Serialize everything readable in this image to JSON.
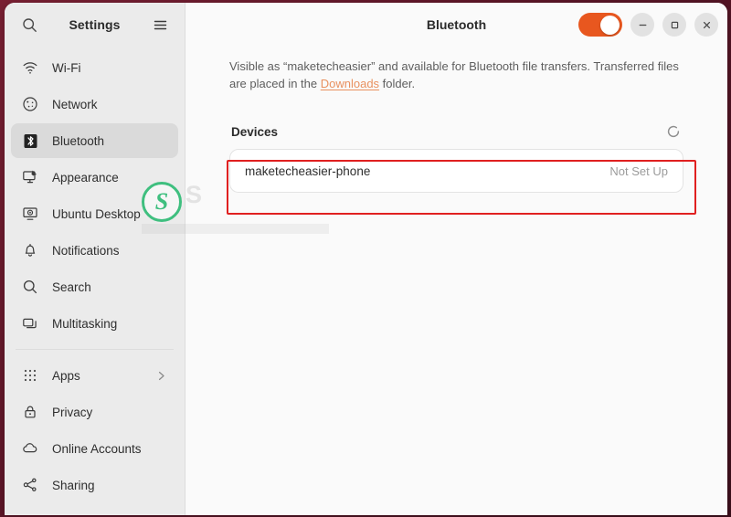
{
  "window": {
    "app_title": "Settings",
    "page_title": "Bluetooth",
    "controls": {
      "minimize_label": "—",
      "maximize_label": "□",
      "close_label": "✕"
    },
    "bluetooth_toggle": {
      "state": "on",
      "accent_color": "#e8571f"
    }
  },
  "sidebar": {
    "title": "Settings",
    "search_icon": "search-icon",
    "menu_icon": "hamburger-menu-icon",
    "groups": [
      {
        "items": [
          {
            "label": "Wi-Fi",
            "icon": "wifi-icon",
            "selected": false
          },
          {
            "label": "Network",
            "icon": "network-icon",
            "selected": false
          },
          {
            "label": "Bluetooth",
            "icon": "bluetooth-icon",
            "selected": true
          },
          {
            "label": "Appearance",
            "icon": "appearance-icon",
            "selected": false
          },
          {
            "label": "Ubuntu Desktop",
            "icon": "ubuntu-desktop-icon",
            "selected": false
          },
          {
            "label": "Notifications",
            "icon": "bell-icon",
            "selected": false
          },
          {
            "label": "Search",
            "icon": "search-icon",
            "selected": false
          },
          {
            "label": "Multitasking",
            "icon": "multitasking-icon",
            "selected": false
          }
        ]
      },
      {
        "items": [
          {
            "label": "Apps",
            "icon": "apps-grid-icon",
            "selected": false,
            "chevron": "›"
          },
          {
            "label": "Privacy",
            "icon": "lock-icon",
            "selected": false
          },
          {
            "label": "Online Accounts",
            "icon": "cloud-icon",
            "selected": false
          },
          {
            "label": "Sharing",
            "icon": "share-nodes-icon",
            "selected": false
          }
        ]
      }
    ]
  },
  "main": {
    "description_part1": "Visible as “maketecheasier” and available for Bluetooth file transfers. Transferred files are placed in the ",
    "description_link": "Downloads",
    "description_part2": " folder.",
    "devices_section": {
      "title": "Devices",
      "refresh_icon": "spinner-refresh-icon",
      "rows": [
        {
          "name": "maketecheasier-phone",
          "status": "Not Set Up"
        }
      ]
    }
  },
  "annotation": {
    "box_color": "#e02020"
  },
  "watermark": {
    "badge_letter": "S",
    "text": "S",
    "sub": "",
    "brand_color": "#3fbf7f"
  }
}
